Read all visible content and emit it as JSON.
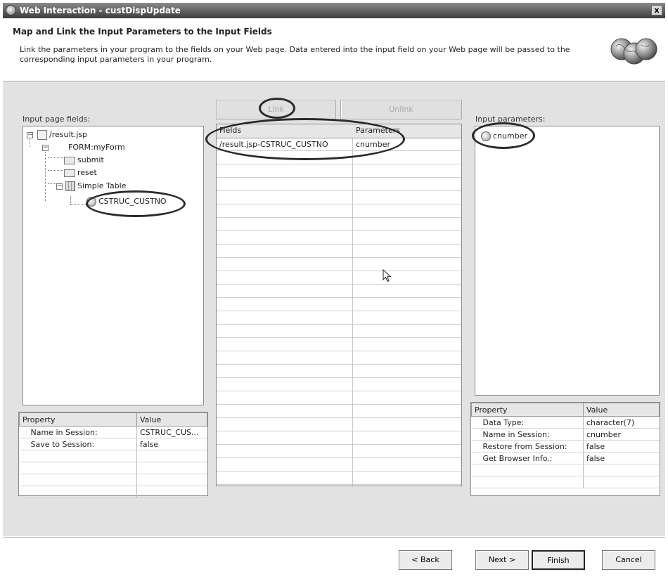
{
  "window": {
    "title": "Web Interaction - custDispUpdate",
    "close_glyph": "x"
  },
  "header": {
    "title": "Map and Link the Input Parameters to the Input Fields",
    "description": "Link the parameters in your program to the fields on your Web page. Data entered into the input field on your Web page will be passed to the corresponding input parameters in your program."
  },
  "left_panel": {
    "label": "Input page fields:",
    "tree": {
      "root": "/result.jsp",
      "form": "FORM:myForm",
      "submit": "submit",
      "reset": "reset",
      "table": "Simple Table",
      "field": "CSTRUC_CUSTNO"
    },
    "properties": {
      "col_property": "Property",
      "col_value": "Value",
      "rows": [
        {
          "name": "Name in Session:",
          "value": "CSTRUC_CUS..."
        },
        {
          "name": "Save to Session:",
          "value": "false"
        }
      ]
    }
  },
  "middle_panel": {
    "link_button": "Link",
    "unlink_button": "Unlink",
    "col_fields": "Fields",
    "col_parameters": "Parameters",
    "rows": [
      {
        "field": "/result.jsp-CSTRUC_CUSTNO",
        "parameter": "cnumber"
      }
    ]
  },
  "right_panel": {
    "label": "Input parameters:",
    "items": [
      "cnumber"
    ],
    "properties": {
      "col_property": "Property",
      "col_value": "Value",
      "rows": [
        {
          "name": "Data Type:",
          "value": "character(7)"
        },
        {
          "name": "Name in Session:",
          "value": "cnumber"
        },
        {
          "name": "Restore from Session:",
          "value": "false"
        },
        {
          "name": "Get Browser Info.:",
          "value": "false"
        }
      ]
    }
  },
  "footer": {
    "back_button": "< Back",
    "next_button": "Next >",
    "finish_button": "Finish",
    "cancel_button": "Cancel"
  },
  "colors": {
    "title_bar": "#3c3c3c",
    "content_bg": "#e2e2e2",
    "annotation": "#2a2a2a"
  }
}
